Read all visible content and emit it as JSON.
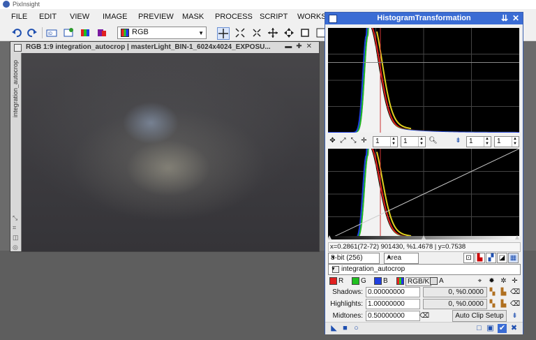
{
  "window": {
    "title": "PixInsight"
  },
  "menu": {
    "items": [
      "FILE",
      "EDIT",
      "VIEW",
      "IMAGE",
      "PREVIEW",
      "MASK",
      "PROCESS",
      "SCRIPT",
      "WORKSP"
    ]
  },
  "toolbar": {
    "channel_select": "RGB"
  },
  "image_window": {
    "title": "RGB 1:9 integration_autocrop | masterLight_BIN-1_6024x4024_EXPOSU...",
    "side_label": "integration_autocrop"
  },
  "histogram": {
    "title": "HistogramTransformation",
    "hidden_title": "HistogramTransformation",
    "top_zoom_h": "1",
    "top_zoom_v": "1",
    "right_zoom_h": "1",
    "right_zoom_v": "1",
    "readout": "x=0.2861(72-72) 901430, %1.4678 | y=0.7538",
    "resolution": "8-bit (256)",
    "graph_style": "Area",
    "view": "integration_autocrop",
    "channels": {
      "r": "R",
      "g": "G",
      "b": "B",
      "rgbk": "RGB/K",
      "a": "A"
    },
    "shadows": {
      "label": "Shadows:",
      "value": "0.00000000",
      "clip": "0, %0.0000"
    },
    "highlights": {
      "label": "Highlights:",
      "value": "1.00000000",
      "clip": "0, %0.0000"
    },
    "midtones": {
      "label": "Midtones:",
      "value": "0.50000000"
    },
    "auto_clip_button": "Auto Clip Setup"
  },
  "colors": {
    "accent": "#3a6cd4",
    "red": "#e02020",
    "green": "#20c020",
    "blue": "#2040e0"
  }
}
